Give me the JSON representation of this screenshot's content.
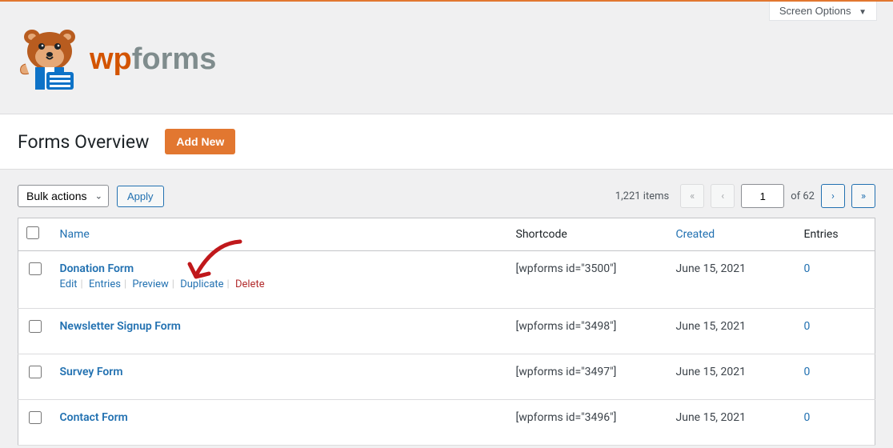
{
  "screen_options_label": "Screen Options",
  "brand": "wpforms",
  "page_title": "Forms Overview",
  "add_new_label": "Add New",
  "bulk_actions_label": "Bulk actions",
  "apply_label": "Apply",
  "items_count": "1,221 items",
  "page_current": "1",
  "page_total_text": "of 62",
  "columns": {
    "name": "Name",
    "shortcode": "Shortcode",
    "created": "Created",
    "entries": "Entries"
  },
  "row_actions": {
    "edit": "Edit",
    "entries": "Entries",
    "preview": "Preview",
    "duplicate": "Duplicate",
    "delete": "Delete"
  },
  "rows": [
    {
      "name": "Donation Form",
      "shortcode": "[wpforms id=\"3500\"]",
      "created": "June 15, 2021",
      "entries": "0"
    },
    {
      "name": "Newsletter Signup Form",
      "shortcode": "[wpforms id=\"3498\"]",
      "created": "June 15, 2021",
      "entries": "0"
    },
    {
      "name": "Survey Form",
      "shortcode": "[wpforms id=\"3497\"]",
      "created": "June 15, 2021",
      "entries": "0"
    },
    {
      "name": "Contact Form",
      "shortcode": "[wpforms id=\"3496\"]",
      "created": "June 15, 2021",
      "entries": "0"
    }
  ]
}
